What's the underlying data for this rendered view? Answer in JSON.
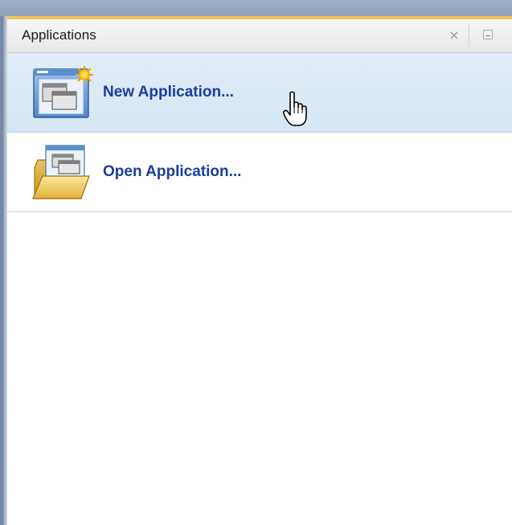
{
  "panel": {
    "title": "Applications",
    "close_glyph": "×"
  },
  "items": [
    {
      "label": "New Application...",
      "icon": "new-application-icon",
      "hovered": true
    },
    {
      "label": "Open Application...",
      "icon": "open-application-icon",
      "hovered": false
    }
  ],
  "colors": {
    "accent_top_border": "#f4c25a",
    "link_text": "#1a3d9e",
    "hover_background": "#dbe9f6",
    "header_background": "#ececec"
  }
}
